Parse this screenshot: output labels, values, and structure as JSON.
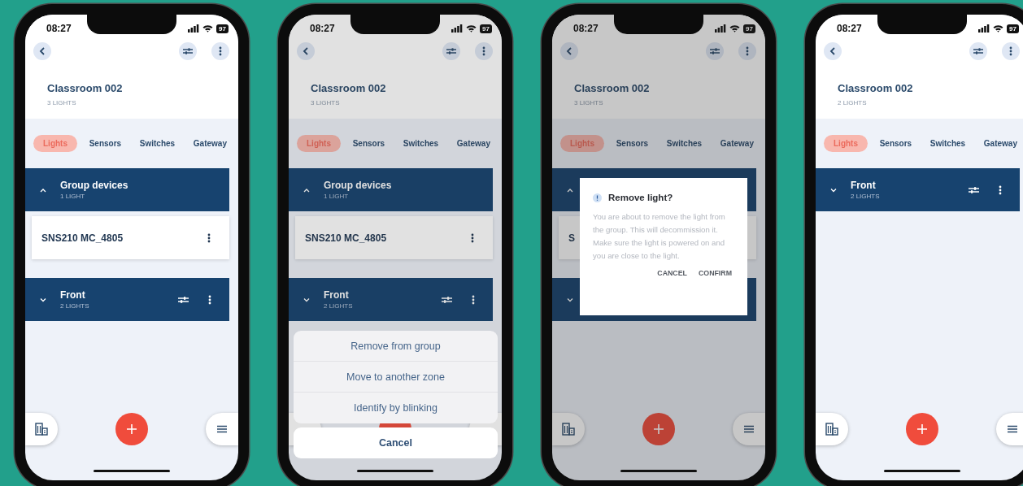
{
  "phones": [
    {
      "status": {
        "time": "08:27",
        "battery": "97"
      },
      "title": "Classroom 002",
      "subtitle": "3 LIGHTS",
      "tabs": [
        {
          "label": "Lights",
          "selected": true
        },
        {
          "label": "Sensors",
          "selected": false
        },
        {
          "label": "Switches",
          "selected": false
        },
        {
          "label": "Gateway",
          "selected": false
        }
      ],
      "groups": [
        {
          "name": "Group devices",
          "count": "1 LIGHT",
          "expanded": true,
          "controls": false,
          "devices": [
            {
              "name": "SNS210 MC_4805",
              "menu": true
            }
          ]
        },
        {
          "name": "Front",
          "count": "2 LIGHTS",
          "expanded": false,
          "controls": true
        }
      ],
      "overlay": {
        "kind": "none"
      }
    },
    {
      "status": {
        "time": "08:27",
        "battery": "97"
      },
      "title": "Classroom 002",
      "subtitle": "3 LIGHTS",
      "tabs": [
        {
          "label": "Lights",
          "selected": true
        },
        {
          "label": "Sensors",
          "selected": false
        },
        {
          "label": "Switches",
          "selected": false
        },
        {
          "label": "Gateway",
          "selected": false
        }
      ],
      "groups": [
        {
          "name": "Group devices",
          "count": "1 LIGHT",
          "expanded": true,
          "controls": false,
          "devices": [
            {
              "name": "SNS210 MC_4805",
              "menu": true
            }
          ]
        },
        {
          "name": "Front",
          "count": "2 LIGHTS",
          "expanded": false,
          "controls": true
        }
      ],
      "overlay": {
        "kind": "action_sheet",
        "options": [
          "Remove from group",
          "Move to another zone",
          "Identify by blinking"
        ],
        "cancel": "Cancel"
      }
    },
    {
      "status": {
        "time": "08:27",
        "battery": "97"
      },
      "title": "Classroom 002",
      "subtitle": "3 LIGHTS",
      "tabs": [
        {
          "label": "Lights",
          "selected": true
        },
        {
          "label": "Sensors",
          "selected": false
        },
        {
          "label": "Switches",
          "selected": false
        },
        {
          "label": "Gateway",
          "selected": false
        }
      ],
      "groups": [
        {
          "expanded": true,
          "controls": false,
          "devices": [
            {
              "name": "S",
              "menu": false
            }
          ]
        },
        {
          "expanded": false,
          "controls": false
        }
      ],
      "overlay": {
        "kind": "dialog",
        "title": "Remove light?",
        "message": "You are about to remove the light from the group. This will decommission it. Make sure the light is powered on and you are close to the light.",
        "buttons": [
          "CANCEL",
          "CONFIRM"
        ]
      }
    },
    {
      "status": {
        "time": "08:27",
        "battery": "97"
      },
      "title": "Classroom 002",
      "subtitle": "2 LIGHTS",
      "tabs": [
        {
          "label": "Lights",
          "selected": true
        },
        {
          "label": "Sensors",
          "selected": false
        },
        {
          "label": "Switches",
          "selected": false
        },
        {
          "label": "Gateway",
          "selected": false
        }
      ],
      "groups": [
        {
          "name": "Front",
          "count": "2 LIGHTS",
          "expanded": false,
          "controls": true
        }
      ],
      "overlay": {
        "kind": "none"
      }
    }
  ]
}
